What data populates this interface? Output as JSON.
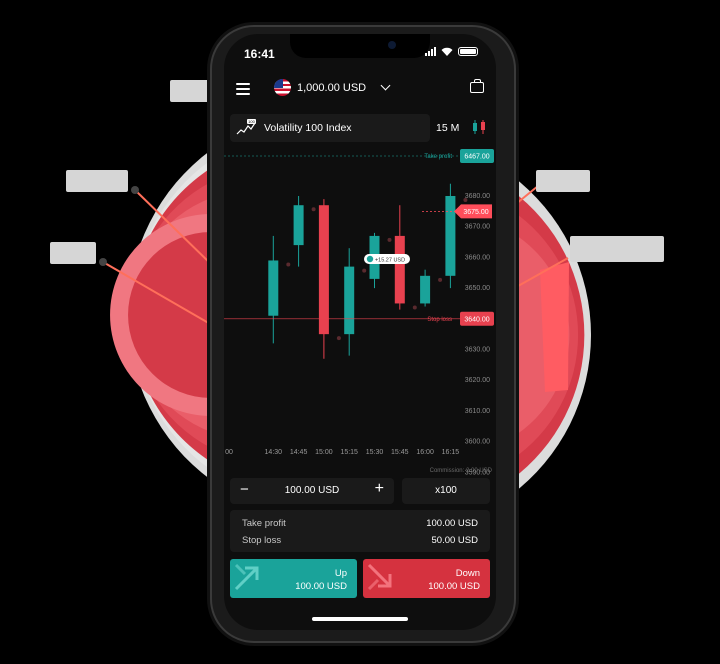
{
  "colors": {
    "up": "#1aa39a",
    "down": "#e8414f",
    "take_profit": "#1aa39a",
    "stop_loss": "#e8414f",
    "spot": "#ff4d5a",
    "background": "#000000",
    "panel": "#1a1a1a"
  },
  "status_bar": {
    "time": "16:41"
  },
  "header": {
    "balance": "1,000.00 USD",
    "menu_icon": "hamburger-icon",
    "account_icon": "us-flag-icon",
    "portfolio_icon": "briefcase-icon"
  },
  "market": {
    "name": "Volatility 100 Index",
    "badge": "100",
    "timeframe": "15 M"
  },
  "chart_data": {
    "type": "candlestick",
    "y_ticks": [
      "3680.00",
      "3670.00",
      "3660.00",
      "3650.00",
      "3640.00",
      "3630.00",
      "3620.00",
      "3610.00",
      "3600.00",
      "3590.00"
    ],
    "x_ticks": [
      "00",
      "14:30",
      "14:45",
      "15:00",
      "15:15",
      "15:30",
      "15:45",
      "16:00",
      "16:15"
    ],
    "candles": [
      {
        "x": "14:30",
        "open": 3641,
        "close": 3659,
        "high": 3667,
        "low": 3632,
        "color": "up"
      },
      {
        "x": "14:45",
        "open": 3664,
        "close": 3677,
        "high": 3680,
        "low": 3657,
        "color": "up"
      },
      {
        "x": "15:00",
        "open": 3677,
        "close": 3635,
        "high": 3679,
        "low": 3627,
        "color": "down"
      },
      {
        "x": "15:15",
        "open": 3635,
        "close": 3657,
        "high": 3663,
        "low": 3628,
        "color": "up"
      },
      {
        "x": "15:30",
        "open": 3653,
        "close": 3667,
        "high": 3668,
        "low": 3650,
        "color": "up"
      },
      {
        "x": "15:45",
        "open": 3667,
        "close": 3645,
        "high": 3677,
        "low": 3643,
        "color": "down"
      },
      {
        "x": "16:00",
        "open": 3645,
        "close": 3654,
        "high": 3656,
        "low": 3644,
        "color": "up"
      },
      {
        "x": "16:15",
        "open": 3654,
        "close": 3680,
        "high": 3684,
        "low": 3650,
        "color": "up"
      }
    ],
    "take_profit": {
      "label": "Take profit",
      "value": "6467.00"
    },
    "spot": {
      "value": "3675.00"
    },
    "stop_loss": {
      "label": "Stop loss",
      "value": "3640.00"
    },
    "position_pl": "+15.27 USD",
    "commission": "Commission: 2.00 USD"
  },
  "trade": {
    "stake": "100.00 USD",
    "minus": "−",
    "plus": "+",
    "multiplier": "x100",
    "take_profit_label": "Take profit",
    "take_profit_value": "100.00 USD",
    "stop_loss_label": "Stop loss",
    "stop_loss_value": "50.00 USD"
  },
  "buttons": {
    "up_label": "Up",
    "up_price": "100.00 USD",
    "down_label": "Down",
    "down_price": "100.00 USD"
  }
}
